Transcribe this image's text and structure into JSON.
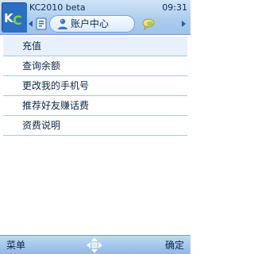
{
  "header": {
    "app_title": "KC2010 beta",
    "time": "09:31",
    "logo_icon": "kc-logo-icon",
    "tabs": {
      "prev_icon": "contact-card-icon",
      "active_label": "账户中心",
      "active_icon": "user-account-icon",
      "next_icon": "chat-bubble-icon"
    }
  },
  "menu": {
    "items": [
      {
        "label": "充值"
      },
      {
        "label": "查询余额"
      },
      {
        "label": "更改我的手机号"
      },
      {
        "label": "推荐好友赚话费"
      },
      {
        "label": "资费说明"
      }
    ]
  },
  "softkeys": {
    "left": "菜单",
    "right": "确定",
    "center_icon": "dpad-icon"
  },
  "colors": {
    "header_blue": "#aecdee",
    "divider": "#a9c6e8",
    "text": "#0f2748"
  }
}
